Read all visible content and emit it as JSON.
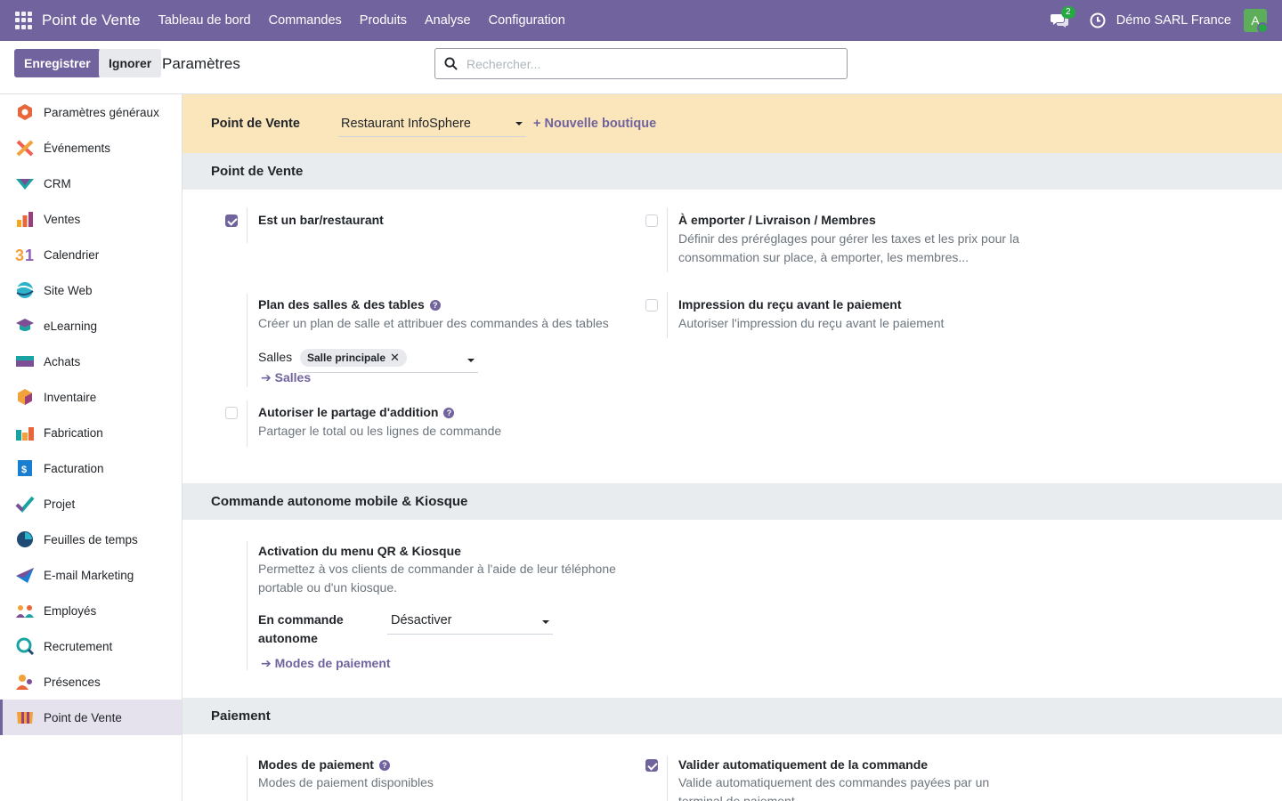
{
  "navbar": {
    "brand": "Point de Vente",
    "menu": [
      "Tableau de bord",
      "Commandes",
      "Produits",
      "Analyse",
      "Configuration"
    ],
    "chat_count": "2",
    "company": "Démo SARL France",
    "avatar_letter": "A"
  },
  "control": {
    "save_label": "Enregistrer",
    "discard_label": "Ignorer",
    "title": "Paramètres",
    "search_placeholder": "Rechercher..."
  },
  "sidebar": {
    "items": [
      {
        "label": "Paramètres généraux",
        "icon": "general-settings-icon"
      },
      {
        "label": "Événements",
        "icon": "events-icon"
      },
      {
        "label": "CRM",
        "icon": "crm-icon"
      },
      {
        "label": "Ventes",
        "icon": "sales-icon"
      },
      {
        "label": "Calendrier",
        "icon": "calendar-icon"
      },
      {
        "label": "Site Web",
        "icon": "website-icon"
      },
      {
        "label": "eLearning",
        "icon": "elearning-icon"
      },
      {
        "label": "Achats",
        "icon": "purchase-icon"
      },
      {
        "label": "Inventaire",
        "icon": "inventory-icon"
      },
      {
        "label": "Fabrication",
        "icon": "manufacturing-icon"
      },
      {
        "label": "Facturation",
        "icon": "invoicing-icon"
      },
      {
        "label": "Projet",
        "icon": "project-icon"
      },
      {
        "label": "Feuilles de temps",
        "icon": "timesheets-icon"
      },
      {
        "label": "E-mail Marketing",
        "icon": "email-marketing-icon"
      },
      {
        "label": "Employés",
        "icon": "employees-icon"
      },
      {
        "label": "Recrutement",
        "icon": "recruitment-icon"
      },
      {
        "label": "Présences",
        "icon": "attendances-icon"
      },
      {
        "label": "Point de Vente",
        "icon": "point-of-sale-icon"
      }
    ],
    "active_index": 17
  },
  "pos_bar": {
    "label": "Point de Vente",
    "selected": "Restaurant InfoSphere",
    "new_shop": "+ Nouvelle boutique"
  },
  "sections": {
    "pos": "Point de Vente",
    "kiosk": "Commande autonome mobile & Kiosque",
    "payment": "Paiement"
  },
  "settings": {
    "bar_restaurant": {
      "title": "Est un bar/restaurant",
      "checked": true
    },
    "takeaway": {
      "title": "À emporter / Livraison / Membres",
      "desc": "Définir des préréglages pour gérer les taxes et les prix pour la consommation sur place, à emporter, les membres...",
      "checked": false
    },
    "floor_plan": {
      "title": "Plan des salles & des tables",
      "desc": "Créer un plan de salle et attribuer des commandes à des tables",
      "field_label": "Salles",
      "tag": "Salle principale",
      "link": "Salles"
    },
    "receipt_print": {
      "title": "Impression du reçu avant le paiement",
      "desc": "Autoriser l'impression du reçu avant le paiement",
      "checked": false
    },
    "split_bill": {
      "title": "Autoriser le partage d'addition",
      "desc": "Partager le total ou les lignes de commande",
      "checked": false
    },
    "qr_menu": {
      "title": "Activation du menu QR & Kiosque",
      "desc": "Permettez à vos clients de commander à l'aide de leur téléphone portable ou d'un kiosque.",
      "field_label": "En commande autonome",
      "field_value": "Désactiver",
      "link": "Modes de paiement"
    },
    "payment_methods": {
      "title": "Modes de paiement",
      "desc": "Modes de paiement disponibles"
    },
    "auto_validate": {
      "title": "Valider automatiquement de la commande",
      "desc": "Valide automatiquement des commandes payées par un terminal de paiement.",
      "checked": true
    }
  },
  "colors": {
    "primary": "#71639e",
    "warning_bar": "#fbe6bc"
  }
}
